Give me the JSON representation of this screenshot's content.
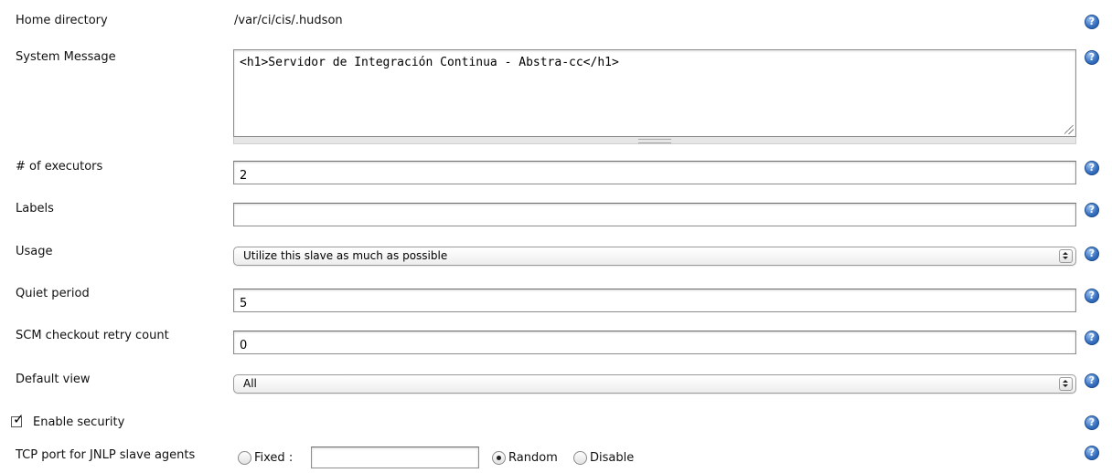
{
  "home_directory": {
    "label": "Home directory",
    "value": "/var/ci/cis/.hudson"
  },
  "system_message": {
    "label": "System Message",
    "value": "<h1>Servidor de Integración Continua - Abstra-cc</h1>"
  },
  "executors": {
    "label": "# of executors",
    "value": "2"
  },
  "labels": {
    "label": "Labels",
    "value": ""
  },
  "usage": {
    "label": "Usage",
    "selected": "Utilize this slave as much as possible"
  },
  "quiet_period": {
    "label": "Quiet period",
    "value": "5"
  },
  "scm_retry": {
    "label": "SCM checkout retry count",
    "value": "0"
  },
  "default_view": {
    "label": "Default view",
    "selected": "All"
  },
  "enable_security": {
    "label": "Enable security",
    "checked": true
  },
  "tcp_port": {
    "label": "TCP port for JNLP slave agents",
    "fixed_label": "Fixed :",
    "fixed_value": "",
    "random_label": "Random",
    "disable_label": "Disable",
    "selected": "Random"
  },
  "help_icon_glyph": "?",
  "icons": {
    "help": "help-icon",
    "checkbox": "checkbox-checked-icon",
    "select": "select-arrows-icon"
  },
  "colors": {
    "help_blue": "#2f66b8"
  }
}
